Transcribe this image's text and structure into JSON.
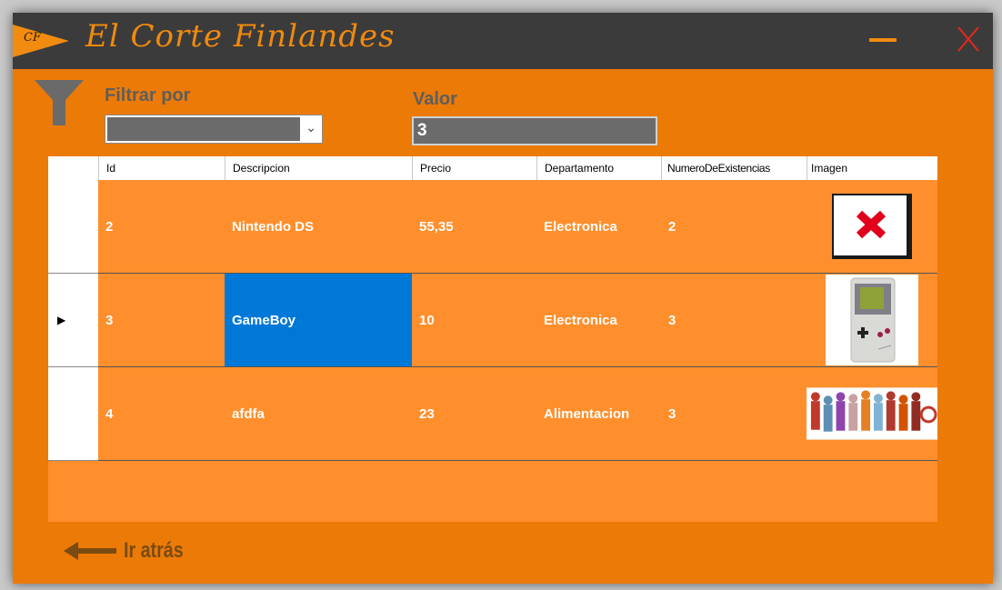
{
  "window": {
    "logo_text": "CF",
    "title": "El Corte Finlandes",
    "colors": {
      "accent": "#ec7a06",
      "titlebar": "#3b3b3b",
      "grid_bg": "#ff8f2d",
      "selection": "#0078d7",
      "close": "#e8271b"
    }
  },
  "filter": {
    "filter_by_label": "Filtrar por",
    "filter_by_value": "",
    "value_label": "Valor",
    "value_input": "3"
  },
  "grid": {
    "columns": [
      "Id",
      "Descripcion",
      "Precio",
      "Departamento",
      "NumeroDeExistencias",
      "Imagen"
    ],
    "rows": [
      {
        "id": "2",
        "descripcion": "Nintendo DS",
        "precio": "55,35",
        "departamento": "Electronica",
        "existencias": "2",
        "imagen": "missing-image-icon"
      },
      {
        "id": "3",
        "descripcion": "GameBoy",
        "precio": "10",
        "departamento": "Electronica",
        "existencias": "3",
        "imagen": "gameboy-image"
      },
      {
        "id": "4",
        "descripcion": "afdfa",
        "precio": "23",
        "departamento": "Alimentacion",
        "existencias": "3",
        "imagen": "people-silhouettes-image"
      }
    ],
    "current_row_marker": "▶"
  },
  "back": {
    "label": "Ir atrás"
  }
}
